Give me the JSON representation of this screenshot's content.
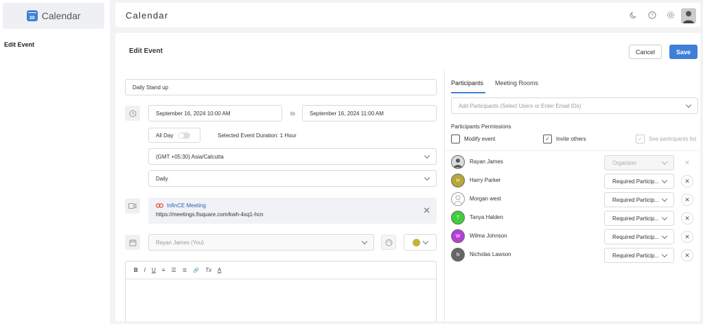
{
  "app": {
    "name": "Calendar",
    "logo_day": "30"
  },
  "left_nav": {
    "current": "Edit Event"
  },
  "topbar": {
    "title": "Calendar",
    "icons": [
      "moon-icon",
      "help-icon",
      "gear-icon"
    ]
  },
  "page": {
    "title": "Edit Event",
    "cancel_label": "Cancel",
    "save_label": "Save"
  },
  "event": {
    "title": "Daily Stand up",
    "start": "September 16, 2024 10:00 AM",
    "to_label": "to",
    "end": "September 16, 2024 11:00 AM",
    "all_day_label": "All Day",
    "all_day": false,
    "duration": "Selected Event Duration: 1 Hour",
    "timezone": "(GMT +05:30) Asia/Calcutta",
    "recurrence": "Daily",
    "meeting": {
      "provider": "InfinCE Meeting",
      "url": "https://meetings.fisquare.com/kwh-4xq1-hcn"
    },
    "calendar_owner": "Rayan James (You)",
    "color": "#c6b23a"
  },
  "editor": {
    "toolbar": [
      "B",
      "I",
      "U",
      "≡",
      "☰",
      "≣",
      "🔗",
      "Tx",
      "A"
    ]
  },
  "tabs": [
    {
      "label": "Participants",
      "active": true
    },
    {
      "label": "Meeting Rooms",
      "active": false
    }
  ],
  "add_participants": {
    "placeholder": "Add Participants (Select Users or Enter Email IDs)"
  },
  "permissions": {
    "heading": "Participants Permissions",
    "modify_event": {
      "label": "Modify event",
      "checked": false
    },
    "invite_others": {
      "label": "Invite others",
      "checked": true
    },
    "see_list": {
      "label": "See participants list",
      "checked": true,
      "disabled": true
    }
  },
  "participants": [
    {
      "name": "Rayan James",
      "role": "Organizer",
      "initial": "",
      "color": "#b0b0b0",
      "locked": true
    },
    {
      "name": "Harry Parker",
      "role": "Required Particip...",
      "initial": "H",
      "color": "#b7a73a",
      "locked": false
    },
    {
      "name": "Morgan west",
      "role": "Required Particip...",
      "initial": "",
      "color": "#ffffff",
      "locked": false
    },
    {
      "name": "Tanya Halden",
      "role": "Required Particip...",
      "initial": "T",
      "color": "#3fcf3a",
      "locked": false
    },
    {
      "name": "Wilma Johnson",
      "role": "Required Particip...",
      "initial": "W",
      "color": "#b43fd8",
      "locked": false
    },
    {
      "name": "Nicholas Lawson",
      "role": "Required Particip...",
      "initial": "N",
      "color": "#666666",
      "locked": false
    }
  ]
}
